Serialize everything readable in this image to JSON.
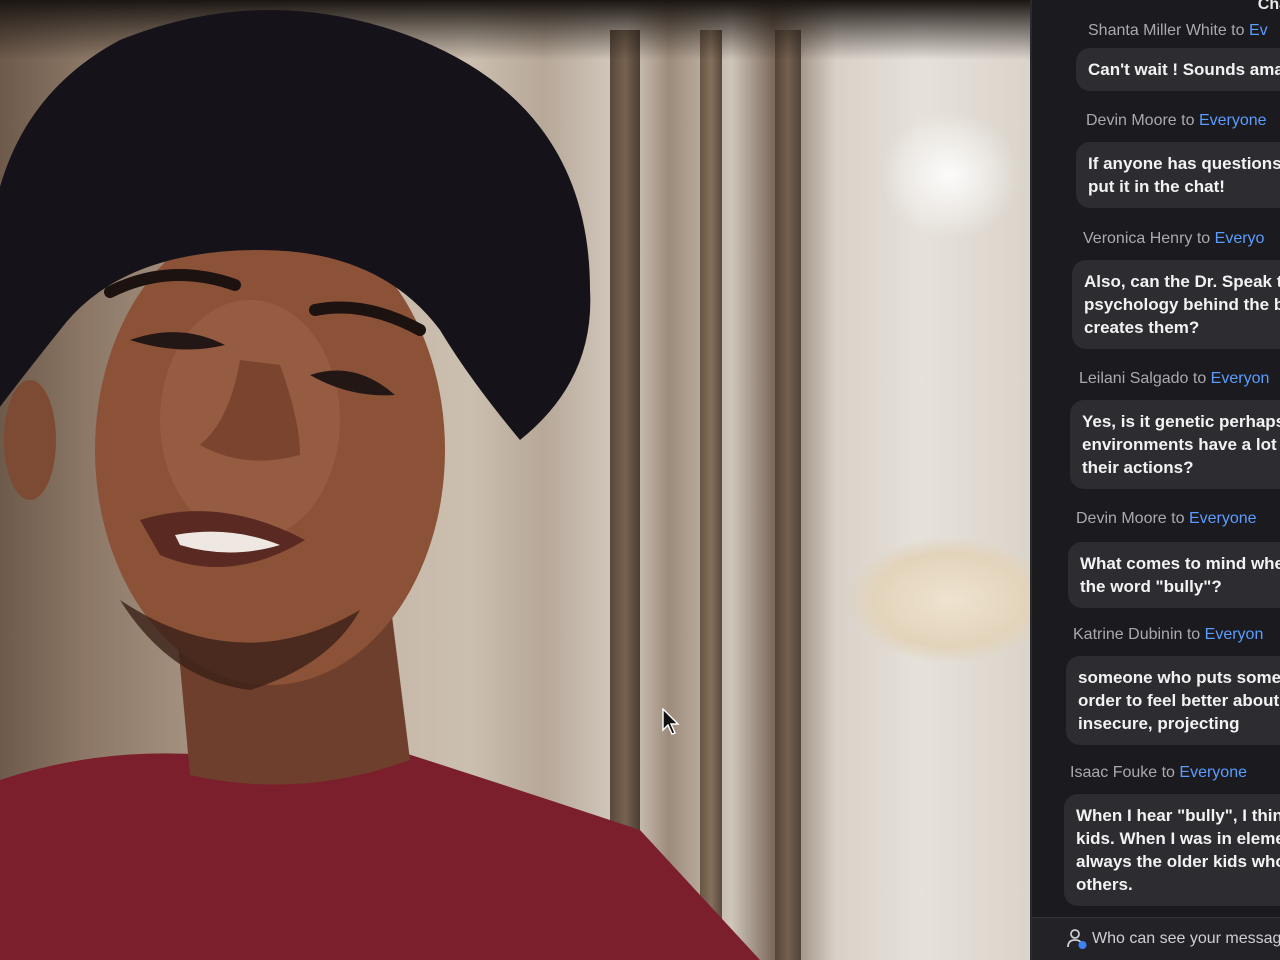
{
  "chat": {
    "title": "Cha",
    "to_word": "to",
    "messages": [
      {
        "sender": "Shanta Miller White",
        "recipient": "Ev",
        "lines": [
          "Can't wait ! Sounds ama"
        ]
      },
      {
        "sender": "Devin Moore",
        "recipient": "Everyone",
        "lines": [
          "If anyone has questions",
          "put it in the chat!"
        ]
      },
      {
        "sender": "Veronica Henry",
        "recipient": "Everyo",
        "lines": [
          "Also, can the Dr. Speak t",
          "psychology behind the b",
          "creates them?"
        ]
      },
      {
        "sender": "Leilani Salgado",
        "recipient": "Everyon",
        "lines": [
          "Yes, is it genetic perhaps",
          "environments have a lot t",
          "their actions?"
        ]
      },
      {
        "sender": "Devin Moore",
        "recipient": "Everyone",
        "lines": [
          "What comes to mind whe",
          "the word \"bully\"?"
        ]
      },
      {
        "sender": "Katrine Dubinin",
        "recipient": "Everyon",
        "lines": [
          "someone who puts someo",
          "order to feel better about",
          "insecure, projecting"
        ]
      },
      {
        "sender": "Isaac Fouke",
        "recipient": "Everyone",
        "lines": [
          "When I hear \"bully\", I think",
          "kids. When I was in elemer",
          "always the older kids who",
          "others."
        ]
      }
    ],
    "footer": {
      "visibility_text": "Who can see your messag"
    }
  },
  "colors": {
    "panel_bg": "#1b1b1f",
    "bubble_bg": "#2c2c31",
    "recipient_accent": "#5b9cff",
    "sender_gray": "#a9a9ae",
    "shirt": "#7a1f2b"
  }
}
